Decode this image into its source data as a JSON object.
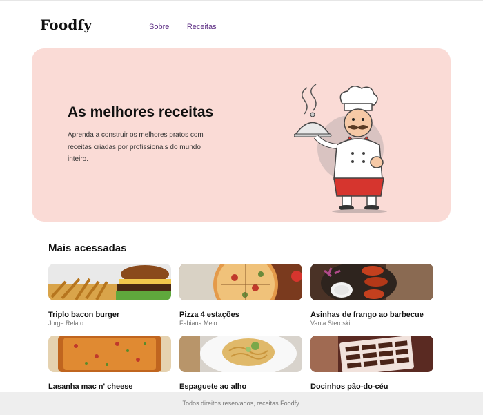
{
  "header": {
    "logo": "Foodfy",
    "nav": [
      "Sobre",
      "Receitas"
    ]
  },
  "hero": {
    "title": "As melhores receitas",
    "description": "Aprenda a construir os melhores pratos com receitas criadas por profissionais do mundo inteiro.",
    "background": "#fadbd6"
  },
  "section": {
    "title": "Mais acessadas"
  },
  "recipes": [
    {
      "name": "Triplo bacon burger",
      "author": "Jorge Relato"
    },
    {
      "name": "Pizza 4 estações",
      "author": "Fabiana Melo"
    },
    {
      "name": "Asinhas de frango ao barbecue",
      "author": "Vania Steroski"
    },
    {
      "name": "Lasanha mac n' cheese",
      "author": ""
    },
    {
      "name": "Espaguete ao alho",
      "author": ""
    },
    {
      "name": "Docinhos pão-do-céu",
      "author": ""
    }
  ],
  "footer": {
    "text": "Todos direitos reservados, receitas Foodfy."
  },
  "colors": {
    "nav_link": "#5a2a82",
    "hero_bg": "#fadbd6",
    "footer_bg": "#eeeeee"
  }
}
